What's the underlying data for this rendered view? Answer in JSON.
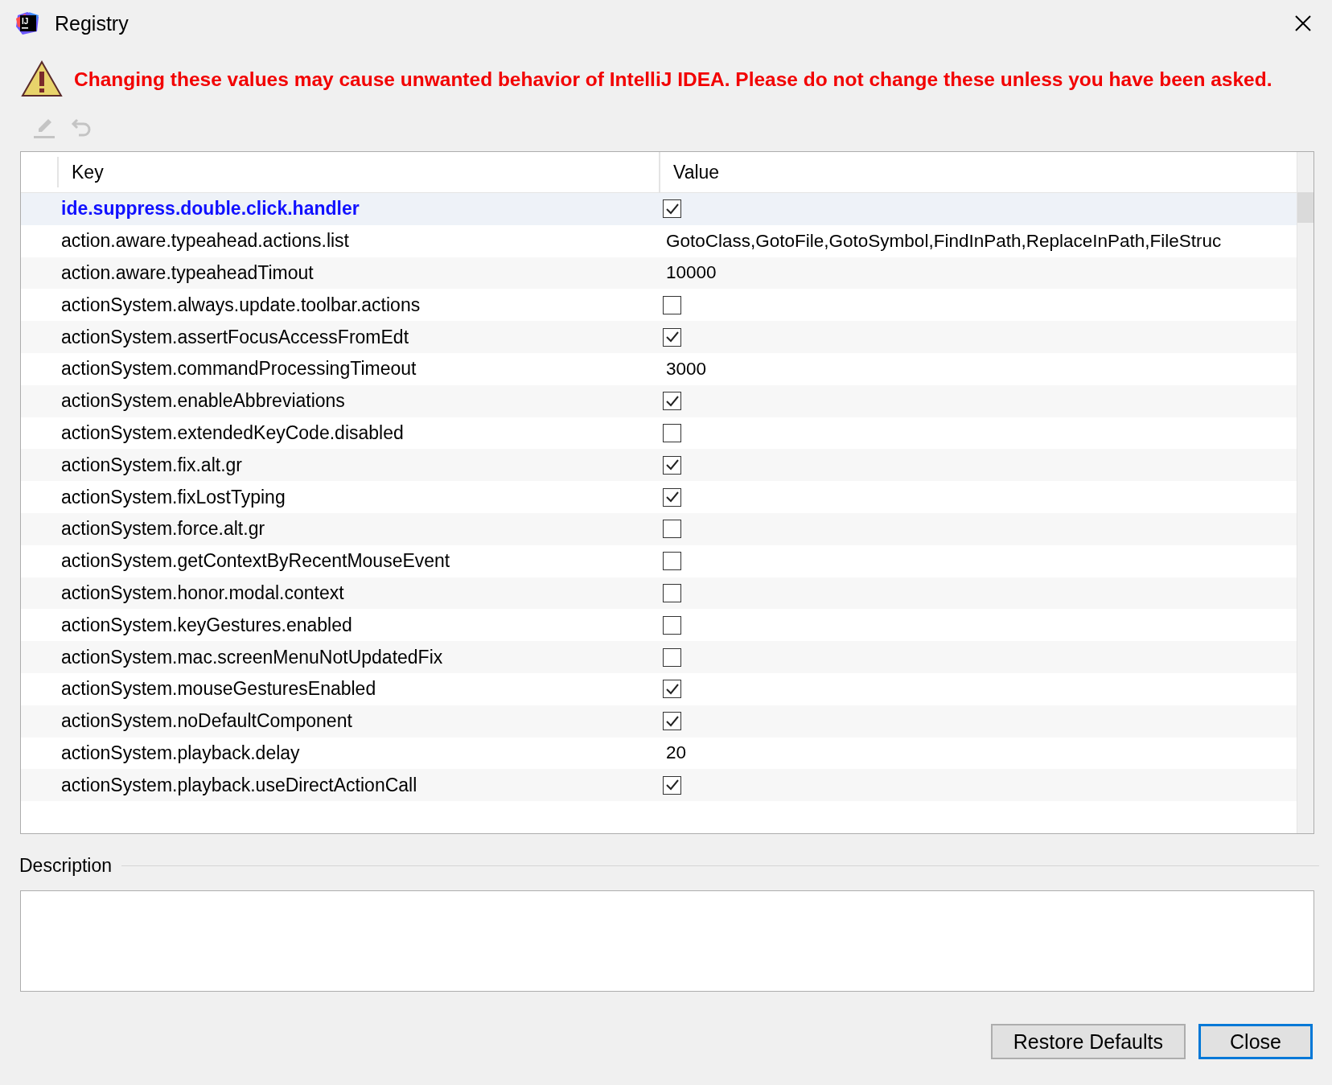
{
  "window": {
    "title": "Registry",
    "icon_text": "IJ"
  },
  "warning": "Changing these values may cause unwanted behavior of IntelliJ IDEA. Please do not change these unless you have been asked.",
  "toolbar": [
    {
      "kind": "edit",
      "disabled": true
    },
    {
      "kind": "revert",
      "disabled": true
    }
  ],
  "table": {
    "columns": [
      "Key",
      "Value"
    ],
    "rows": [
      {
        "key": "ide.suppress.double.click.handler",
        "kind": "checkbox",
        "checked": true,
        "selected": true
      },
      {
        "key": "action.aware.typeahead.actions.list",
        "kind": "text",
        "value": "GotoClass,GotoFile,GotoSymbol,FindInPath,ReplaceInPath,FileStruc",
        "selected": false
      },
      {
        "key": "action.aware.typeaheadTimout",
        "kind": "text",
        "value": "10000",
        "selected": false
      },
      {
        "key": "actionSystem.always.update.toolbar.actions",
        "kind": "checkbox",
        "checked": false,
        "selected": false
      },
      {
        "key": "actionSystem.assertFocusAccessFromEdt",
        "kind": "checkbox",
        "checked": true,
        "selected": false
      },
      {
        "key": "actionSystem.commandProcessingTimeout",
        "kind": "text",
        "value": "3000",
        "selected": false
      },
      {
        "key": "actionSystem.enableAbbreviations",
        "kind": "checkbox",
        "checked": true,
        "selected": false
      },
      {
        "key": "actionSystem.extendedKeyCode.disabled",
        "kind": "checkbox",
        "checked": false,
        "selected": false
      },
      {
        "key": "actionSystem.fix.alt.gr",
        "kind": "checkbox",
        "checked": true,
        "selected": false
      },
      {
        "key": "actionSystem.fixLostTyping",
        "kind": "checkbox",
        "checked": true,
        "selected": false
      },
      {
        "key": "actionSystem.force.alt.gr",
        "kind": "checkbox",
        "checked": false,
        "selected": false
      },
      {
        "key": "actionSystem.getContextByRecentMouseEvent",
        "kind": "checkbox",
        "checked": false,
        "selected": false
      },
      {
        "key": "actionSystem.honor.modal.context",
        "kind": "checkbox",
        "checked": false,
        "selected": false
      },
      {
        "key": "actionSystem.keyGestures.enabled",
        "kind": "checkbox",
        "checked": false,
        "selected": false
      },
      {
        "key": "actionSystem.mac.screenMenuNotUpdatedFix",
        "kind": "checkbox",
        "checked": false,
        "selected": false
      },
      {
        "key": "actionSystem.mouseGesturesEnabled",
        "kind": "checkbox",
        "checked": true,
        "selected": false
      },
      {
        "key": "actionSystem.noDefaultComponent",
        "kind": "checkbox",
        "checked": true,
        "selected": false
      },
      {
        "key": "actionSystem.playback.delay",
        "kind": "text",
        "value": "20",
        "selected": false
      },
      {
        "key": "actionSystem.playback.useDirectActionCall",
        "kind": "checkbox",
        "checked": true,
        "selected": false
      }
    ]
  },
  "description": {
    "label": "Description"
  },
  "buttons": [
    {
      "label": "Restore Defaults",
      "default": false
    },
    {
      "label": "Close",
      "default": true
    }
  ]
}
